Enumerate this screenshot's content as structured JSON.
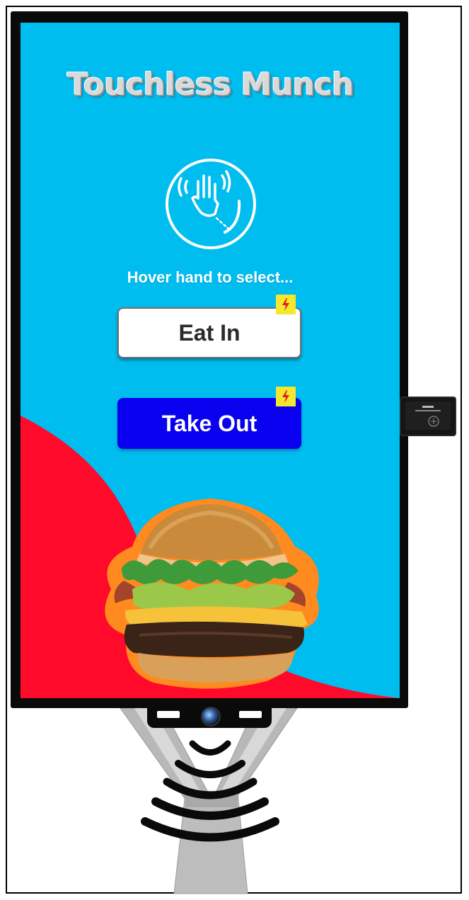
{
  "app": {
    "title": "Touchless Munch"
  },
  "instruction": {
    "text": "Hover hand to select..."
  },
  "options": [
    {
      "label": "Eat In",
      "badge_icon": "lightning-icon"
    },
    {
      "label": "Take Out",
      "badge_icon": "lightning-icon"
    }
  ],
  "icons": {
    "gesture": "hand-wave-gesture-icon",
    "badge": "lightning-icon",
    "food": "burger-image",
    "camera": "camera-icon"
  },
  "colors": {
    "screen_bg": "#00bdf0",
    "accent_red": "#ff0a2a",
    "take_out_button": "#0a00f0",
    "eat_in_button": "#ffffff",
    "badge": "#f5e62e"
  }
}
